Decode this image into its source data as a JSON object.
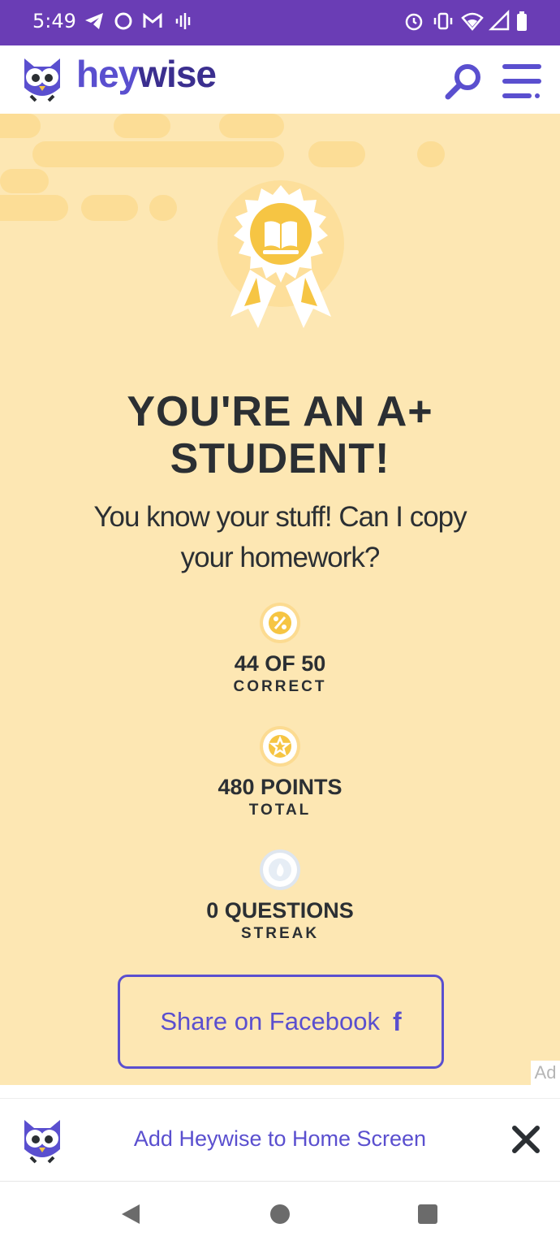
{
  "status_bar": {
    "time": "5:49",
    "left_icons": [
      "telegram-icon",
      "circle-icon",
      "gmail-icon",
      "podcast-icon"
    ],
    "right_icons": [
      "alarm-icon",
      "vibrate-icon",
      "wifi-icon",
      "signal-icon",
      "battery-icon"
    ]
  },
  "header": {
    "logo_part1": "hey",
    "logo_part2": "wise",
    "search_icon": "search-icon",
    "menu_icon": "menu-icon"
  },
  "result": {
    "headline_line1": "YOU'RE AN A+",
    "headline_line2": "STUDENT!",
    "subline_line1": "You know your stuff! Can I copy",
    "subline_line2": "your homework?"
  },
  "stats": [
    {
      "icon": "percent-icon",
      "value": "44 OF 50",
      "label": "CORRECT"
    },
    {
      "icon": "star-icon",
      "value": "480 POINTS",
      "label": "TOTAL"
    },
    {
      "icon": "flame-icon",
      "value": "0 QUESTIONS",
      "label": "STREAK"
    }
  ],
  "share": {
    "label": "Share on Facebook",
    "icon_glyph": "f"
  },
  "ad_label": "Ad",
  "add_to_home": {
    "label": "Add Heywise to Home Screen"
  },
  "colors": {
    "brand_purple": "#5a4fcf",
    "status_bar": "#6a3db5",
    "background": "#fde7b3",
    "badge_gold": "#f6c543"
  }
}
